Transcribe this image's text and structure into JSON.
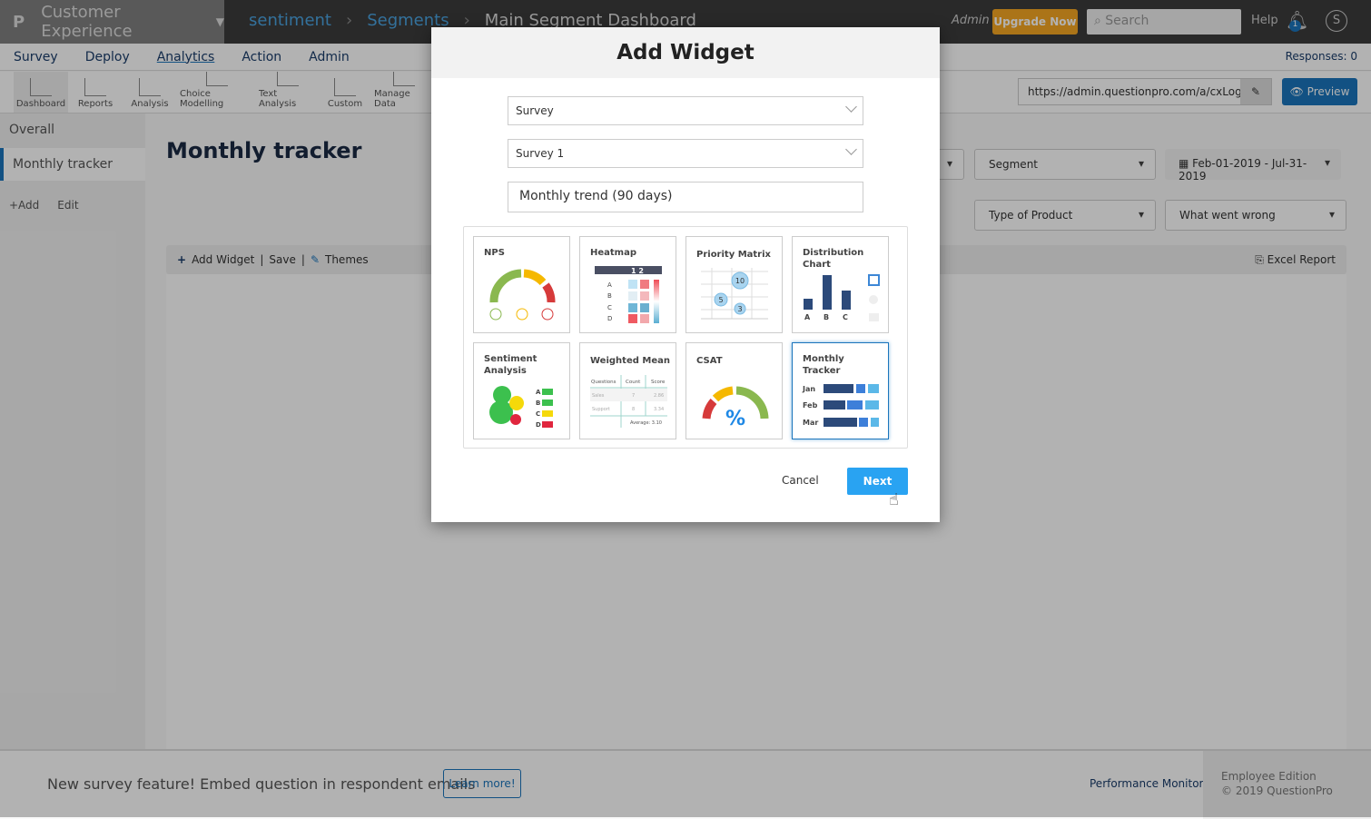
{
  "topbar": {
    "app": "Customer Experience",
    "breadcrumbs": [
      "sentiment",
      "Segments",
      "Main Segment Dashboard"
    ],
    "role": "Admin",
    "upgrade": "Upgrade Now",
    "search_placeholder": "Search",
    "help": "Help",
    "notif_count": "1",
    "avatar": "S"
  },
  "nav": {
    "items": [
      "Survey",
      "Deploy",
      "Analytics",
      "Action",
      "Admin"
    ],
    "active": "Analytics",
    "responses": "Responses: 0"
  },
  "subnav": {
    "items": [
      "Dashboard",
      "Reports",
      "Analysis",
      "Choice Modelling",
      "Text Analysis",
      "Custom",
      "Manage Data"
    ],
    "url": "https://admin.questionpro.com/a/cxLogin.",
    "preview": "Preview"
  },
  "sidebar": {
    "items": [
      "Overall",
      "Monthly tracker"
    ],
    "add": "+Add",
    "edit": "Edit"
  },
  "main": {
    "title": "Monthly tracker",
    "filters": {
      "segment": "Segment",
      "date": "Feb-01-2019 - Jul-31-2019",
      "type": "Type of Product",
      "wrong": "What went wrong"
    },
    "toolbar": {
      "add": "Add Widget",
      "save": "Save",
      "themes": "Themes",
      "excel": "Excel Report"
    }
  },
  "footer": {
    "message": "New survey feature! Embed question in respondent emails",
    "learn": "Learn more!",
    "perf": "Performance Monitor",
    "edition": "Employee Edition",
    "copy": "© 2019 QuestionPro"
  },
  "modal": {
    "title": "Add Widget",
    "select1": "Survey",
    "select2": "Survey 1",
    "name_value": "Monthly trend (90 days)",
    "widgets": [
      {
        "label": "NPS"
      },
      {
        "label": "Heatmap"
      },
      {
        "label": "Priority Matrix"
      },
      {
        "label": "Distribution Chart"
      },
      {
        "label": "Sentiment Analysis"
      },
      {
        "label": "Weighted Mean"
      },
      {
        "label": "CSAT"
      },
      {
        "label": "Monthly Tracker",
        "selected": true
      }
    ],
    "thumb_text": {
      "heat_cols": "1 2",
      "rows": [
        "A",
        "B",
        "C",
        "D"
      ],
      "dist_cats": [
        "A",
        "B",
        "C"
      ],
      "pm_vals": [
        "10",
        "5",
        "3"
      ],
      "wm_headers": [
        "Questions",
        "Count",
        "Score"
      ],
      "wm_rows": [
        [
          "Sales",
          "7",
          "2.86"
        ],
        [
          "Support",
          "8",
          "3.34"
        ]
      ],
      "wm_avg": "Average: 3.10",
      "csat_sym": "%",
      "months": [
        "Jan",
        "Feb",
        "Mar"
      ]
    },
    "cancel": "Cancel",
    "next": "Next"
  },
  "colors": {
    "accent": "#1b75bc",
    "upgrade": "#f5a623",
    "next": "#29a3f2"
  }
}
